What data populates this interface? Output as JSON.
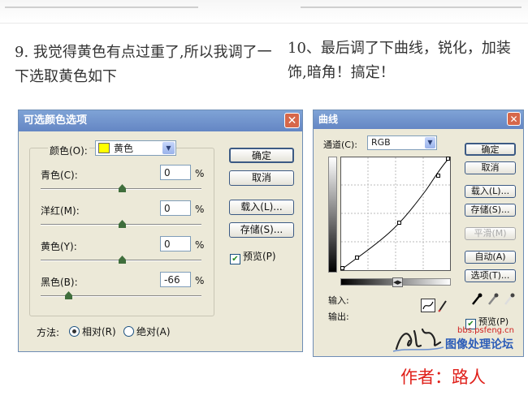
{
  "captions": {
    "step9": "9. 我觉得黄色有点过重了,所以我调了一下选取黄色如下",
    "step10": "10、最后调了下曲线，锐化，加装饰,暗角！搞定！"
  },
  "selective_color": {
    "title": "可选颜色选项",
    "color_label": "颜色(O):",
    "color_value": "黄色",
    "swatch": "#ffff00",
    "cyan_label": "青色(C):",
    "cyan_value": "0",
    "magenta_label": "洋红(M):",
    "magenta_value": "0",
    "yellow_label": "黄色(Y):",
    "yellow_value": "0",
    "black_label": "黑色(B):",
    "black_value": "-66",
    "percent": "%",
    "buttons": {
      "ok": "确定",
      "cancel": "取消",
      "load": "载入(L)...",
      "save": "存储(S)..."
    },
    "preview_label": "预览(P)",
    "method_label": "方法:",
    "relative_label": "相对(R)",
    "absolute_label": "绝对(A)"
  },
  "curves": {
    "title": "曲线",
    "channel_label": "通道(C):",
    "channel_value": "RGB",
    "input_label": "输入:",
    "output_label": "输出:",
    "buttons": {
      "ok": "确定",
      "cancel": "取消",
      "load": "载入(L)...",
      "save": "存储(S)...",
      "smooth": "平滑(M)",
      "auto": "自动(A)",
      "options": "选项(T)..."
    },
    "preview_label": "预览(P)"
  },
  "watermark": {
    "url": "bbs.psfeng.cn",
    "name": "图像处理论坛"
  },
  "author": "作者：路人"
}
